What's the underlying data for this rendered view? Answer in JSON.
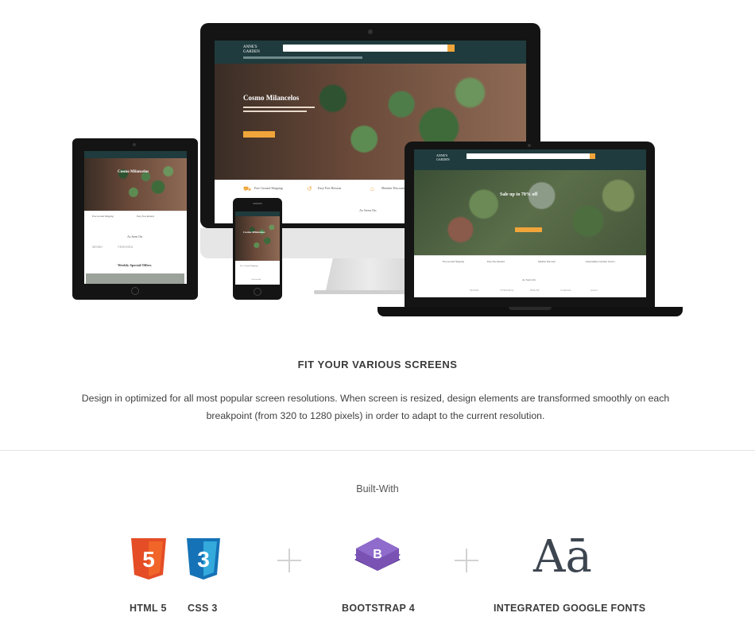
{
  "mockup": {
    "brand": "ANNE'S GARDEN",
    "hero_title": "Cosmo Milancelos",
    "laptop_hero_title": "Sale up to 70% off",
    "features": [
      "Free Ground Shipping",
      "Easy Free Returns",
      "Member Discount",
      "Outstanding Customer Service"
    ],
    "seen_on": "As Seen On",
    "weekly": "Weekly Special Offers",
    "brands": [
      "MOMO",
      "VERANDA",
      "HOUSE",
      "Southside",
      "sunset"
    ]
  },
  "fit": {
    "title": "FIT YOUR VARIOUS SCREENS",
    "description": "Design in optimized for all most popular screen resolutions. When screen is resized, design elements are transformed smoothly on each breakpoint (from 320 to 1280 pixels) in order to adapt to the current resolution."
  },
  "built": {
    "title": "Built-With",
    "items": [
      {
        "label": "HTML 5",
        "icon": "html5-icon",
        "badge": "5"
      },
      {
        "label": "CSS 3",
        "icon": "css3-icon",
        "badge": "3"
      },
      {
        "label": "BOOTSTRAP 4",
        "icon": "bootstrap-icon",
        "badge": "B"
      },
      {
        "label": "INTEGRATED GOOGLE FONTS",
        "icon": "google-fonts-icon",
        "badge": "Aā"
      }
    ]
  },
  "colors": {
    "html5": "#e44d26",
    "css3": "#1572b6",
    "bootstrap": "#6a3fb5",
    "accent": "#f0a53a",
    "nav": "#1f3b3d"
  }
}
